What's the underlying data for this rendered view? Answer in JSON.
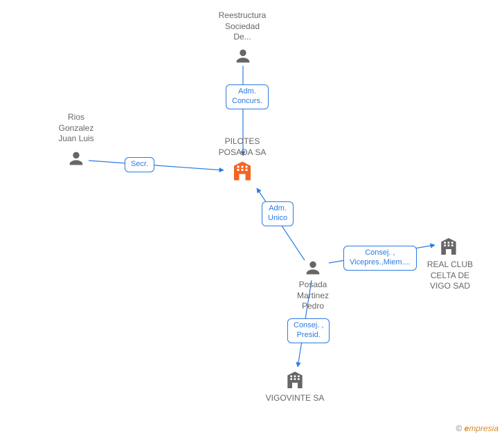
{
  "nodes": {
    "reestructura": {
      "label": "Reestructura\nSociedad\nDe...",
      "type": "person"
    },
    "rios": {
      "label": "Rios\nGonzalez\nJuan Luis",
      "type": "person"
    },
    "posada_martinez": {
      "label": "Posada\nMartinez\nPedro",
      "type": "person"
    },
    "pilotes": {
      "label": "PILOTES\nPOSADA SA",
      "type": "company_primary"
    },
    "realclub": {
      "label": "REAL CLUB\nCELTA DE\nVIGO SAD",
      "type": "company"
    },
    "vigovinte": {
      "label": "VIGOVINTE SA",
      "type": "company"
    }
  },
  "edges": {
    "reestructura_pilotes": {
      "label": "Adm.\nConcurs."
    },
    "rios_pilotes": {
      "label": "Secr."
    },
    "posada_pilotes": {
      "label": "Adm.\nUnico"
    },
    "posada_realclub": {
      "label": "Consej. ,\nVicepres.,Miem...."
    },
    "posada_vigovinte": {
      "label": "Consej. ,\nPresid."
    }
  },
  "footer": {
    "copyright": "©",
    "brand": "mpresia",
    "brand_e": "e"
  },
  "colors": {
    "edge": "#2a7ae2",
    "person": "#666666",
    "company": "#666666",
    "primary": "#f26522"
  }
}
